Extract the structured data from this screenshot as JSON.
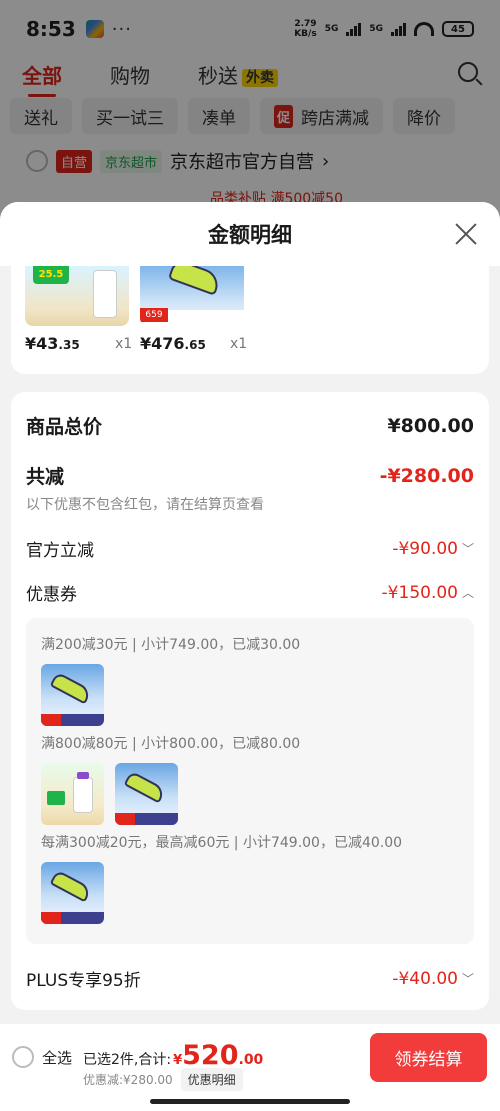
{
  "status_bar": {
    "time": "8:53",
    "dots": "···",
    "speed_top": "2.79",
    "speed_bottom": "KB/s",
    "sig1": "5G",
    "sig2": "5G",
    "battery": "45"
  },
  "nav": {
    "tabs": [
      {
        "label": "全部"
      },
      {
        "label": "购物"
      },
      {
        "label": "秒送"
      }
    ],
    "waimai_badge": "外卖"
  },
  "chips": [
    {
      "label": "送礼"
    },
    {
      "label": "买一试三"
    },
    {
      "label": "凑单"
    },
    {
      "label": "跨店满减",
      "badge": "促"
    },
    {
      "label": "降价"
    }
  ],
  "store": {
    "tag_ziying": "自营",
    "tag_chaoshi": "京东超市",
    "name": "京东超市官方自营",
    "chevron": "›",
    "promo": "品类补贴 满500减50"
  },
  "sheet": {
    "title": "金额明细",
    "products": [
      {
        "price_int": "¥43",
        "price_dec": ".35",
        "qty": "x1",
        "thumb_tag": "25.5"
      },
      {
        "price_int": "¥476",
        "price_dec": ".65",
        "qty": "x1",
        "thumb_price": "659"
      }
    ],
    "total": {
      "label": "商品总价",
      "value": "¥800.00"
    },
    "reduction": {
      "label": "共减",
      "value": "-¥280.00"
    },
    "note": "以下优惠不包含红包，请在结算页查看",
    "official": {
      "label": "官方立减",
      "value": "-¥90.00",
      "chevron": "﹀"
    },
    "coupon": {
      "label": "优惠券",
      "value": "-¥150.00",
      "chevron": "︿"
    },
    "coupon_groups": [
      {
        "text": "满200减30元 | 小计749.00，已减30.00"
      },
      {
        "text": "满800减80元 | 小计800.00，已减80.00"
      },
      {
        "text": "每满300减20元，最高减60元 | 小计749.00，已减40.00"
      }
    ],
    "plus": {
      "label": "PLUS专享95折",
      "value": "-¥40.00",
      "chevron": "﹀"
    }
  },
  "footer": {
    "select_all": "全选",
    "summary_label": "已选2件,合计:",
    "currency": "¥",
    "total_int": "520",
    "total_dec": ".00",
    "discount": "优惠减:¥280.00",
    "detail_link": "优惠明细",
    "checkout": "领券结算"
  },
  "colors": {
    "accent": "#e1251b",
    "button": "#f23b3b"
  }
}
